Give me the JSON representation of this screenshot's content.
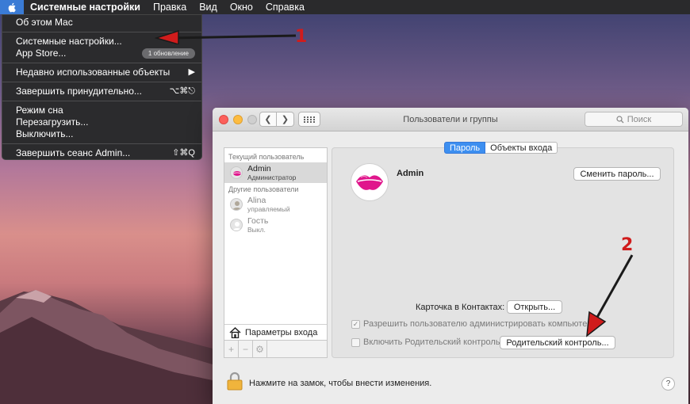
{
  "menubar": {
    "app_name": "Системные настройки",
    "items": [
      "Правка",
      "Вид",
      "Окно",
      "Справка"
    ]
  },
  "apple_menu": {
    "about": "Об этом Mac",
    "system_prefs": "Системные настройки...",
    "app_store": "App Store...",
    "app_store_badge": "1 обновление",
    "recent_items": "Недавно использованные объекты",
    "force_quit": "Завершить принудительно...",
    "force_quit_shortcut": "⌥⌘⎋",
    "sleep": "Режим сна",
    "restart": "Перезагрузить...",
    "shutdown": "Выключить...",
    "logout": "Завершить сеанс Admin...",
    "logout_shortcut": "⇧⌘Q"
  },
  "annotations": {
    "step1": "1",
    "step2": "2"
  },
  "window": {
    "title": "Пользователи и группы",
    "search_placeholder": "Поиск"
  },
  "sidebar": {
    "current_header": "Текущий пользователь",
    "current_user": {
      "name": "Admin",
      "role": "Администратор"
    },
    "other_header": "Другие пользователи",
    "others": [
      {
        "name": "Alina",
        "role": "управляемый"
      },
      {
        "name": "Гость",
        "role": "Выкл."
      }
    ],
    "login_options": "Параметры входа",
    "tools": [
      "+",
      "−",
      "⚙"
    ]
  },
  "panel": {
    "tabs": {
      "password": "Пароль",
      "login_items": "Объекты входа"
    },
    "user_name": "Admin",
    "change_password": "Сменить пароль...",
    "contacts_card_label": "Карточка в Контактах:",
    "open_button": "Открыть...",
    "allow_admin": "Разрешить пользователю администрировать компьютер",
    "enable_parental": "Включить Родительский контроль",
    "parental_button": "Родительский контроль..."
  },
  "footer": {
    "lock_text": "Нажмите на замок, чтобы внести изменения.",
    "help": "?"
  },
  "colors": {
    "accent": "#3d8ff0",
    "annotation": "#d01c1c",
    "menubar": "#2a2a2c"
  }
}
